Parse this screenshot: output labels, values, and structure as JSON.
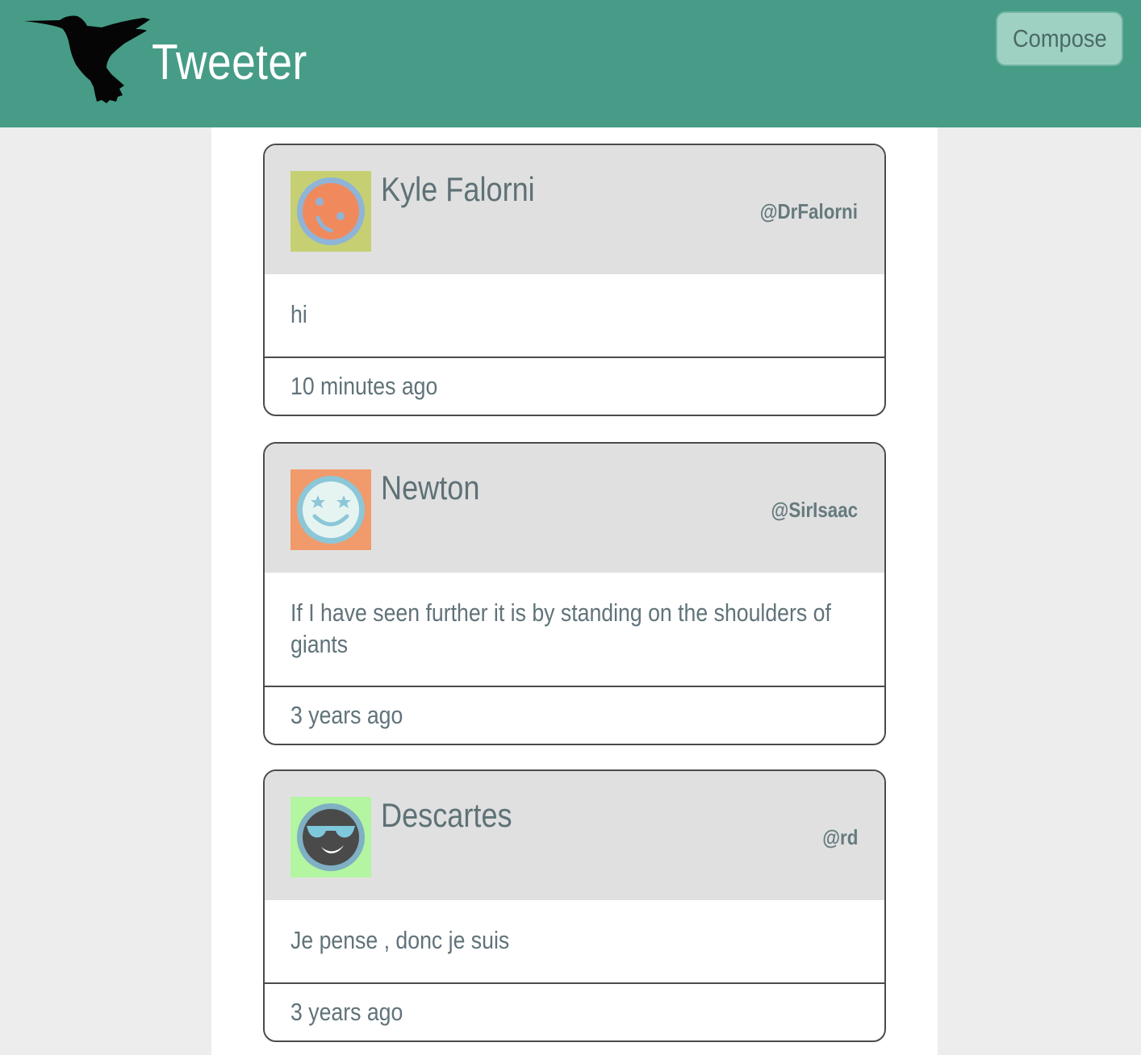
{
  "navbar": {
    "brand": "Tweeter",
    "logo_icon": "hummingbird-icon",
    "compose_label": "Compose",
    "background": "#469c87"
  },
  "tweets": [
    {
      "name": "Kyle Falorni",
      "handle": "@DrFalorni",
      "text": "hi",
      "time": "10 minutes ago",
      "avatar": {
        "icon": "sad-face-avatar-icon",
        "bg": "#c6d073",
        "face": "#f08a5d",
        "ring": "#8fb4d8"
      }
    },
    {
      "name": "Newton",
      "handle": "@SirIsaac",
      "text": "If I have seen further it is by standing on the shoulders of giants",
      "time": "3 years ago",
      "avatar": {
        "icon": "star-eyes-face-avatar-icon",
        "bg": "#f19a6b",
        "face": "#e6f4f1",
        "ring": "#8cc7d8"
      }
    },
    {
      "name": "Descartes",
      "handle": "@rd",
      "text": "Je pense , donc je suis",
      "time": "3 years ago",
      "avatar": {
        "icon": "sunglasses-face-avatar-icon",
        "bg": "#b3f5a1",
        "face": "#4a4a4a",
        "ring": "#7fb0c4"
      }
    }
  ]
}
